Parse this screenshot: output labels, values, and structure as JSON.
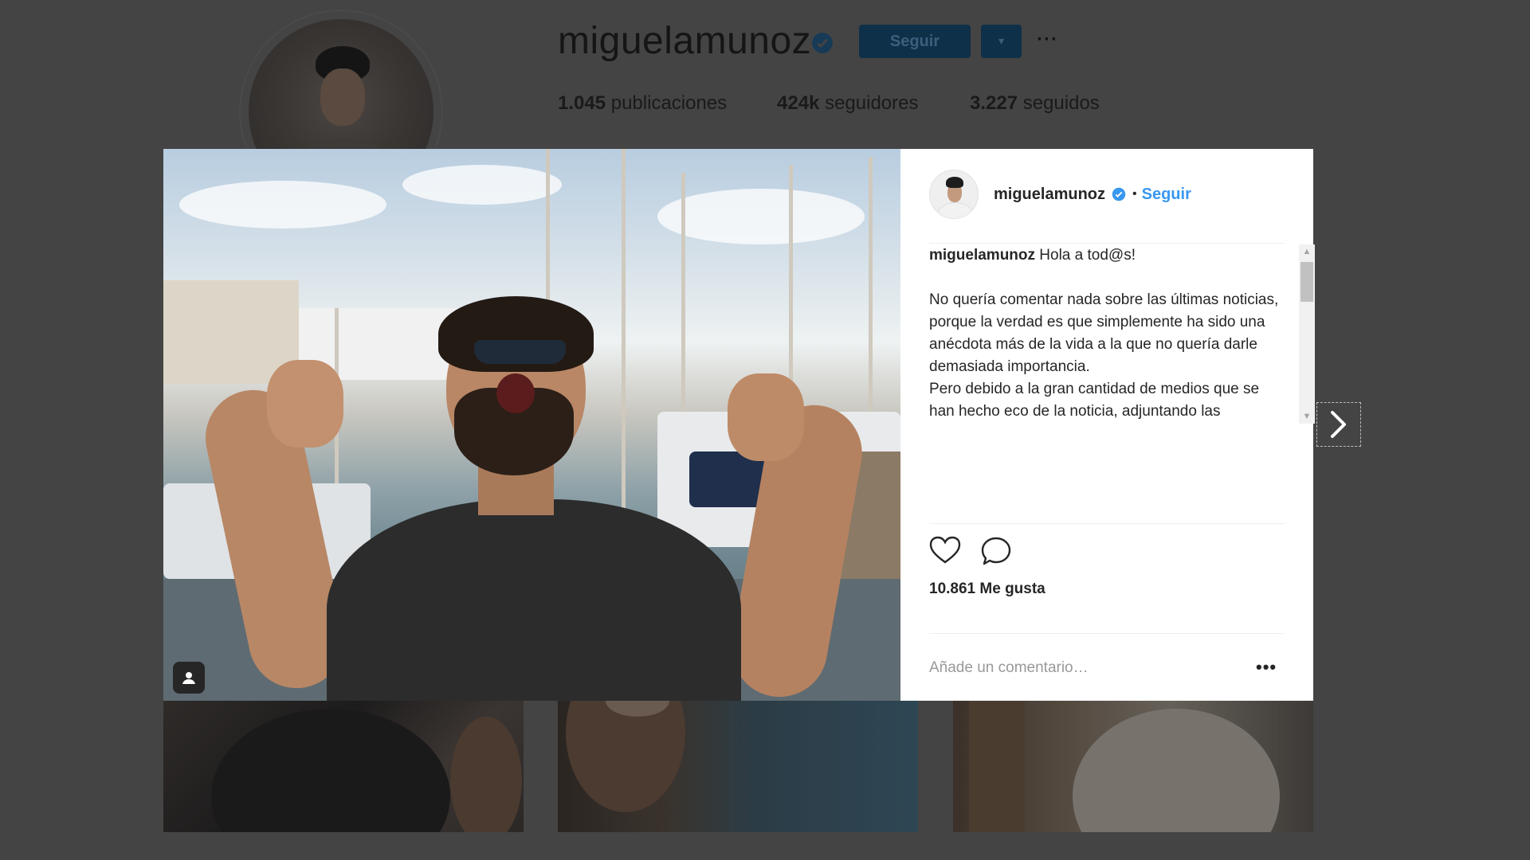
{
  "profile": {
    "username": "miguelamunoz",
    "follow_label": "Seguir",
    "dropdown_icon": "caret-down-icon",
    "more_icon": "more-horizontal-icon",
    "stats": {
      "posts_value": "1.045",
      "posts_label": "publicaciones",
      "followers_value": "424k",
      "followers_label": "seguidores",
      "following_value": "3.227",
      "following_label": "seguidos"
    }
  },
  "post": {
    "username": "miguelamunoz",
    "separator": "•",
    "follow_label": "Seguir",
    "caption_username": "miguelamunoz",
    "caption_text": " Hola a tod@s!\n\nNo quería comentar nada sobre las últimas noticias, porque la verdad es que simplemente ha sido una anécdota más de la vida a la que no quería darle demasiada importancia.\nPero debido a la gran cantidad de medios que se han hecho eco de la noticia, adjuntando las impactantes fotografías del accidente y por tanto la preocupación de mucha gente me decido a escribir estas",
    "likes": "10.861 Me gusta",
    "comment_placeholder": "Añade un comentario…",
    "more_label": "•••"
  },
  "icons": {
    "verified": "verified-badge-icon",
    "like": "heart-icon",
    "comment": "comment-bubble-icon",
    "user_tag": "user-tag-icon",
    "next": "chevron-right-icon"
  },
  "colors": {
    "accent": "#3897f0",
    "verified": "#3897f0",
    "overlay": "#444444"
  }
}
